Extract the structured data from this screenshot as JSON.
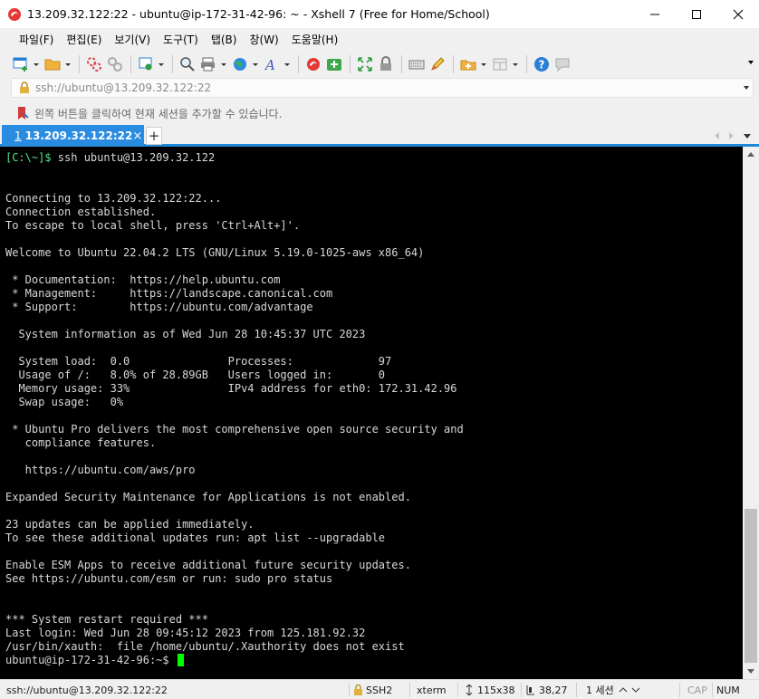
{
  "window": {
    "title": "13.209.32.122:22 - ubuntu@ip-172-31-42-96: ~ - Xshell 7 (Free for Home/School)"
  },
  "menu": [
    "파일(F)",
    "편집(E)",
    "보기(V)",
    "도구(T)",
    "탭(B)",
    "창(W)",
    "도움말(H)"
  ],
  "address": {
    "value": "ssh://ubuntu@13.209.32.122:22"
  },
  "hint": "왼쪽 버튼을 클릭하여 현재 세션을 추가할 수 있습니다.",
  "tab": {
    "number": "1",
    "label": "13.209.32.122:22",
    "close": "×",
    "add": "+"
  },
  "terminal": {
    "prompt_local": "[C:\\~]$",
    "command_local": " ssh ubuntu@13.209.32.122",
    "lines": [
      "",
      "",
      "Connecting to 13.209.32.122:22...",
      "Connection established.",
      "To escape to local shell, press 'Ctrl+Alt+]'.",
      "",
      "Welcome to Ubuntu 22.04.2 LTS (GNU/Linux 5.19.0-1025-aws x86_64)",
      "",
      " * Documentation:  https://help.ubuntu.com",
      " * Management:     https://landscape.canonical.com",
      " * Support:        https://ubuntu.com/advantage",
      "",
      "  System information as of Wed Jun 28 10:45:37 UTC 2023",
      "",
      "  System load:  0.0               Processes:             97",
      "  Usage of /:   8.0% of 28.89GB   Users logged in:       0",
      "  Memory usage: 33%               IPv4 address for eth0: 172.31.42.96",
      "  Swap usage:   0%",
      "",
      " * Ubuntu Pro delivers the most comprehensive open source security and",
      "   compliance features.",
      "",
      "   https://ubuntu.com/aws/pro",
      "",
      "Expanded Security Maintenance for Applications is not enabled.",
      "",
      "23 updates can be applied immediately.",
      "To see these additional updates run: apt list --upgradable",
      "",
      "Enable ESM Apps to receive additional future security updates.",
      "See https://ubuntu.com/esm or run: sudo pro status",
      "",
      "",
      "*** System restart required ***",
      "Last login: Wed Jun 28 09:45:12 2023 from 125.181.92.32",
      "/usr/bin/xauth:  file /home/ubuntu/.Xauthority does not exist"
    ],
    "prompt_remote": "ubuntu@ip-172-31-42-96:~$ "
  },
  "status": {
    "connection": "ssh://ubuntu@13.209.32.122:22",
    "protocol": "SSH2",
    "terminal_type": "xterm",
    "size": "115x38",
    "cursor_pos": "38,27",
    "sessions": "1 세션",
    "caps": "CAP",
    "num": "NUM"
  },
  "colors": {
    "tab_active": "#2a8ce0",
    "terminal_bg": "#000000",
    "prompt_green": "#57e389",
    "cursor": "#00ff00"
  }
}
